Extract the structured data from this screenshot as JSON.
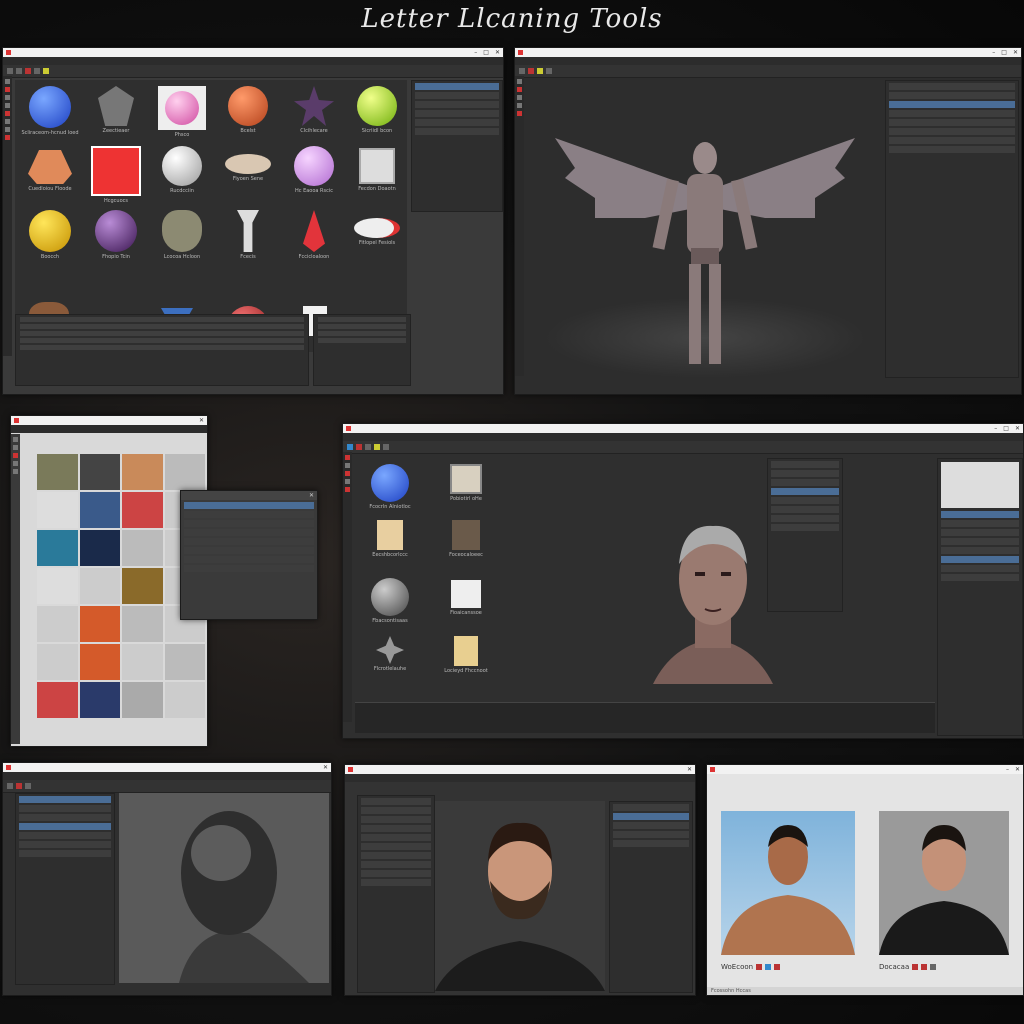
{
  "page": {
    "title": "Letter Llcaning Tools"
  },
  "colors": {
    "window_bg": "#3a3a3a",
    "panel_bg": "#2e2e2e",
    "selection": "#4a6d96",
    "accent_red": "#cc3333"
  },
  "icons": [
    "sphere-icon",
    "gear-icon",
    "close-icon",
    "minimize-icon",
    "maximize-icon"
  ],
  "win1": {
    "tiles": [
      {
        "label": "Scliraceom-hcnud loed"
      },
      {
        "label": "Zeectieaer"
      },
      {
        "label": "Phsco"
      },
      {
        "label": "Bcelst"
      },
      {
        "label": "Clcihlecare"
      },
      {
        "label": "Sicriidl bcon"
      },
      {
        "label": "Cuedloiou Floode"
      },
      {
        "label": "Hcgcuocs"
      },
      {
        "label": "Rucdcciin"
      },
      {
        "label": "Fiyoen Sene"
      },
      {
        "label": "Hc Eaooa Rscic"
      },
      {
        "label": "Fecdon Doaotn"
      },
      {
        "label": "Boocch"
      },
      {
        "label": "Fhopio Tcin"
      },
      {
        "label": "Lcocoa Hcloon"
      },
      {
        "label": "Fcecis"
      },
      {
        "label": "Fccicloaloon"
      },
      {
        "label": "Fitlopel Fesiols"
      }
    ]
  },
  "win5": {
    "tiles": [
      {
        "label": "Fcocrln Alniotloc"
      },
      {
        "label": "Pobiotirl oHe"
      },
      {
        "label": "Eecshbcorlccc"
      },
      {
        "label": "Foceocaloeec"
      },
      {
        "label": "Fbacsontisaas"
      },
      {
        "label": "Fioaicanssoe"
      },
      {
        "label": "Flcrotlelauhe"
      },
      {
        "label": "Locieyd Fhccnoot"
      }
    ]
  },
  "win8": {
    "badge": "WoEcoon",
    "name": "Docacaa"
  },
  "footer": {
    "status": "Fcossohn Hccas"
  }
}
